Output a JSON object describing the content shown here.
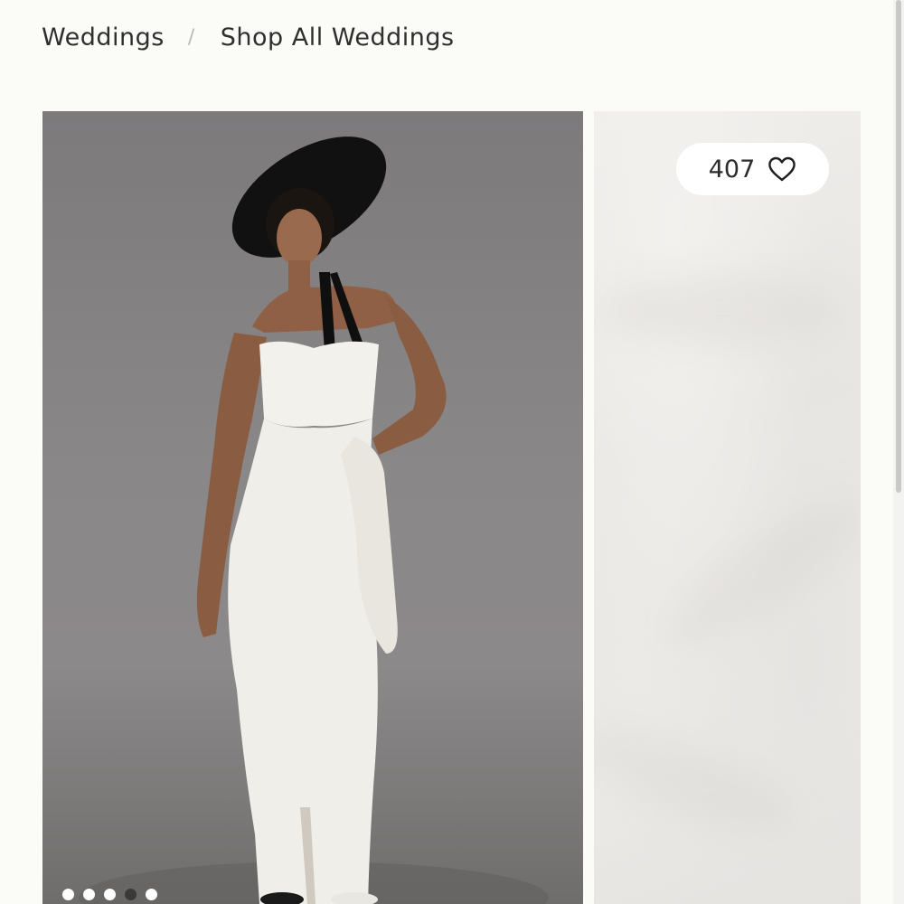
{
  "breadcrumb": {
    "items": [
      {
        "label": "Weddings"
      },
      {
        "label": "Shop All Weddings"
      }
    ],
    "separator": "/"
  },
  "gallery": {
    "main_image_alt": "Model in white strapless column gown with side sash, black wide-brim hat and black neck ribbon",
    "dots_count": 5,
    "active_dot_index": 3
  },
  "detail": {
    "like_count": "407",
    "like_icon": "heart-icon"
  },
  "colors": {
    "background": "#fbfbf8",
    "text": "#2b2b2b",
    "dot_active": "#3a3a3a",
    "dot_inactive": "#ffffff"
  }
}
